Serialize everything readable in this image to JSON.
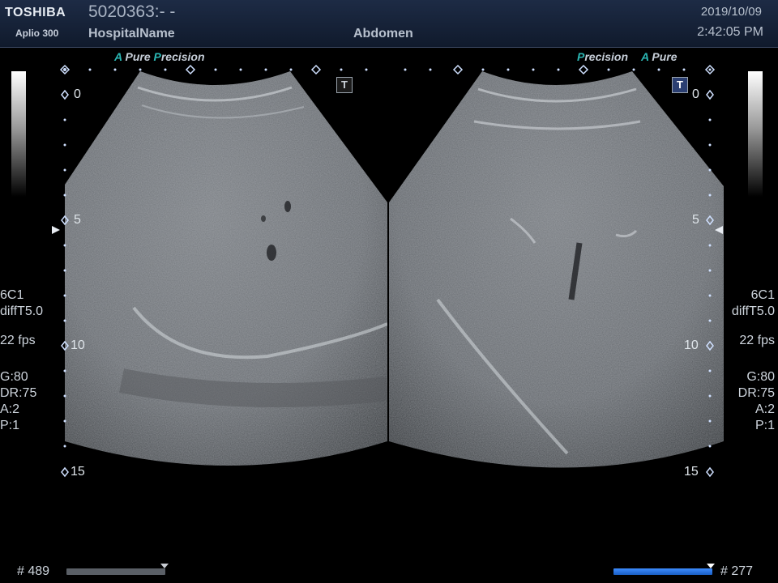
{
  "header": {
    "brand": "TOSHIBA",
    "model": "Aplio 300",
    "patient_id": "5020363:- -",
    "hospital": "HospitalName",
    "exam": "Abdomen",
    "date": "2019/10/09",
    "time": "2:42:05 PM"
  },
  "left_panel": {
    "tag_a": "A",
    "tag_pure": "Pure",
    "tag_p": "P",
    "tag_precision": "recision",
    "depth_labels": [
      "0",
      "5",
      "10",
      "15"
    ],
    "probe": "6C1",
    "preset": "diffT5.0",
    "fps": "22 fps",
    "gain": "G:80",
    "dynamic_range": "DR:75",
    "a_value": "A:2",
    "p_value": "P:1",
    "frame_label": "# 489",
    "cine_position": 1.0,
    "t_marker": "T"
  },
  "right_panel": {
    "tag_p": "P",
    "tag_precision": "recision",
    "tag_a": "A",
    "tag_pure": "Pure",
    "depth_labels": [
      "0",
      "5",
      "10",
      "15"
    ],
    "probe": "6C1",
    "preset": "diffT5.0",
    "fps": "22 fps",
    "gain": "G:80",
    "dynamic_range": "DR:75",
    "a_value": "A:2",
    "p_value": "P:1",
    "frame_label": "# 277",
    "cine_position": 1.0,
    "t_marker": "T"
  },
  "colors": {
    "accent_teal": "#2bb7b4",
    "cine_left": "#5a5f66",
    "cine_right": "#1f6fd6",
    "marker_blue": "#cfe0ff"
  }
}
